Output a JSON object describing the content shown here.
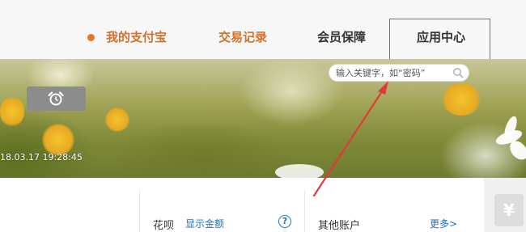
{
  "nav": {
    "mine": "我的支付宝",
    "trade": "交易记录",
    "member": "会员保障",
    "app_center": "应用中心"
  },
  "search": {
    "placeholder": "输入关键字，如“密码”",
    "icon": "search-icon"
  },
  "banner": {
    "timestamp": "18.03.17 19:28:45",
    "alarm_icon": "alarm-clock-icon"
  },
  "huabei": {
    "label": "花呗",
    "show_amount": "显示金额",
    "help": "?"
  },
  "other_accounts": {
    "label": "其他账户",
    "more": "更多>"
  },
  "side": {
    "yen": "¥"
  },
  "colors": {
    "nav_active": "#d4702a",
    "highlight_box": "#d9434b",
    "link": "#1a73c4"
  }
}
